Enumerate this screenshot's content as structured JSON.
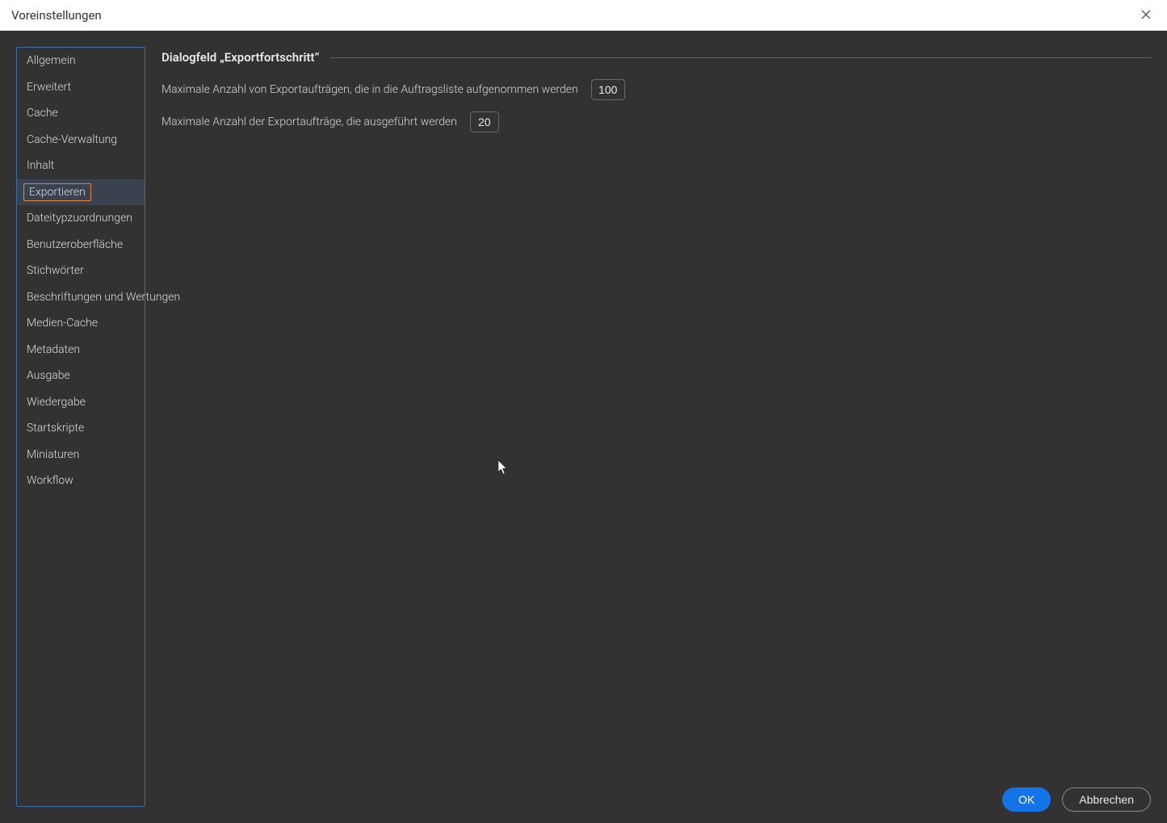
{
  "titlebar": {
    "title": "Voreinstellungen",
    "close_label": "X"
  },
  "sidebar": {
    "items": [
      {
        "label": "Allgemein",
        "selected": false
      },
      {
        "label": "Erweitert",
        "selected": false
      },
      {
        "label": "Cache",
        "selected": false
      },
      {
        "label": "Cache-Verwaltung",
        "selected": false
      },
      {
        "label": "Inhalt",
        "selected": false
      },
      {
        "label": "Exportieren",
        "selected": true
      },
      {
        "label": "Dateitypzuordnungen",
        "selected": false
      },
      {
        "label": "Benutzeroberfläche",
        "selected": false
      },
      {
        "label": "Stichwörter",
        "selected": false
      },
      {
        "label": "Beschriftungen und Wertungen",
        "selected": false
      },
      {
        "label": "Medien-Cache",
        "selected": false
      },
      {
        "label": "Metadaten",
        "selected": false
      },
      {
        "label": "Ausgabe",
        "selected": false
      },
      {
        "label": "Wiedergabe",
        "selected": false
      },
      {
        "label": "Startskripte",
        "selected": false
      },
      {
        "label": "Miniaturen",
        "selected": false
      },
      {
        "label": "Workflow",
        "selected": false
      }
    ]
  },
  "main": {
    "section_title": "Dialogfeld „Exportfortschritt“",
    "field1": {
      "label": "Maximale Anzahl von Exportaufträgen, die in die Auftragsliste aufgenommen werden",
      "value": "100"
    },
    "field2": {
      "label": "Maximale Anzahl der Exportaufträge, die ausgeführt werden",
      "value": "20"
    }
  },
  "footer": {
    "ok": "OK",
    "cancel": "Abbrechen"
  }
}
